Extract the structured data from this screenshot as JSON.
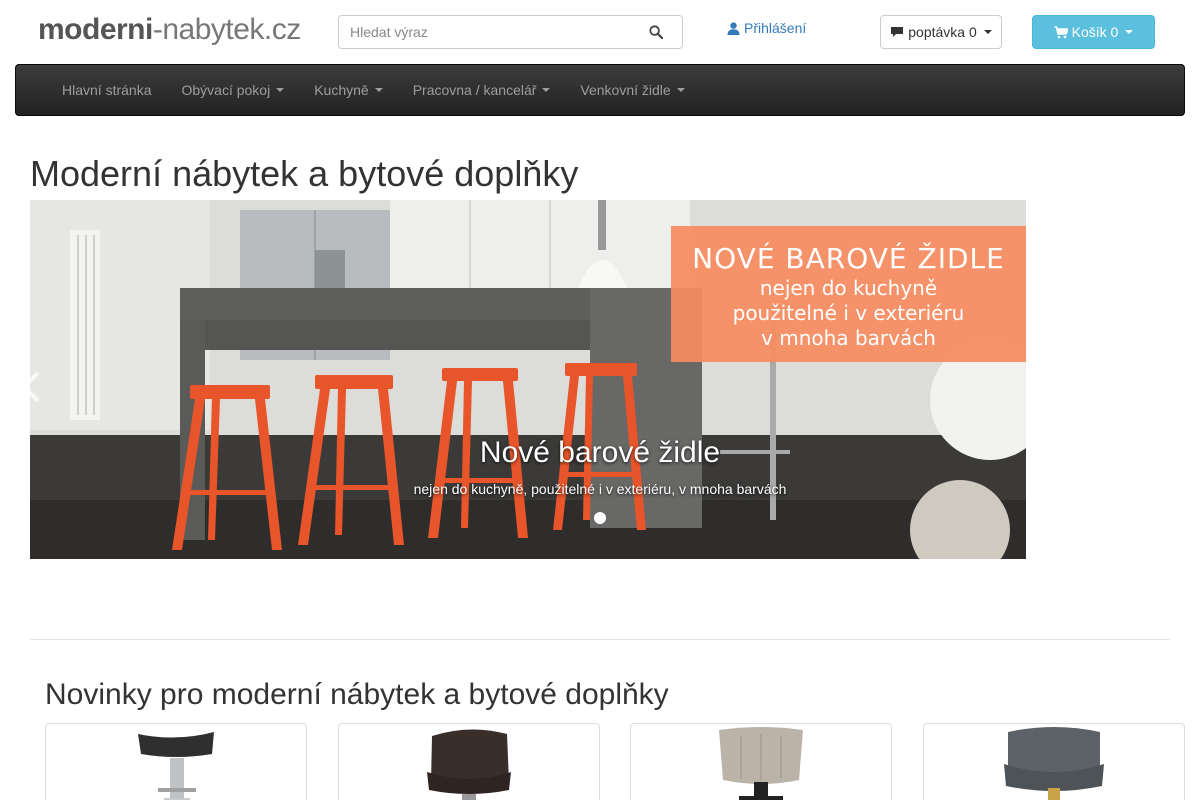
{
  "header": {
    "logo_part1": "moderni",
    "logo_part2": "-nabytek.cz",
    "search": {
      "placeholder": "Hledat výraz"
    },
    "login_label": "Přihlášení",
    "inquiry_label": "poptávka 0",
    "cart_label": "Košík 0"
  },
  "nav": {
    "items": [
      {
        "label": "Hlavní stránka",
        "dropdown": false
      },
      {
        "label": "Obývací pokoj",
        "dropdown": true
      },
      {
        "label": "Kuchyně",
        "dropdown": true
      },
      {
        "label": "Pracovna / kancelář",
        "dropdown": true
      },
      {
        "label": "Venkovní židle",
        "dropdown": true
      }
    ]
  },
  "page_title": "Moderní nábytek a bytové doplňky",
  "carousel": {
    "banner": {
      "title": "NOVÉ BAROVÉ ŽIDLE",
      "line1": "nejen do kuchyně",
      "line2": "použitelné i v exteriéru",
      "line3": "v mnoha barvách"
    },
    "caption_title": "Nové barové židle",
    "caption_text": "nejen do kuchyně, použitelné i v exteriéru, v mnoha barvách",
    "slide_count": 1,
    "active_slide": 1
  },
  "section_title": "Novinky pro moderní nábytek a bytové doplňky",
  "colors": {
    "accent": "#337ab7",
    "cart_button": "#5bc0de",
    "navbar": "#222222",
    "banner": "#f78c60",
    "stool_orange": "#e8552a"
  },
  "icons": [
    "search-icon",
    "user-icon",
    "comment-icon",
    "shopping-cart-icon",
    "chevron-left-icon",
    "chevron-right-icon"
  ]
}
